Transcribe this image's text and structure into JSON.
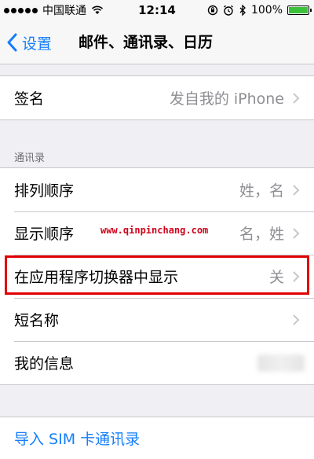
{
  "status_bar": {
    "carrier": "中国联通",
    "time": "12:14",
    "battery_percent": "100%",
    "battery_level": 1.0,
    "icons": [
      "signal-icon",
      "wifi-icon",
      "orientation-lock-icon",
      "alarm-icon",
      "bluetooth-icon",
      "battery-icon"
    ]
  },
  "nav": {
    "back_label": "设置",
    "title": "邮件、通讯录、日历"
  },
  "signature": {
    "label": "签名",
    "value": "发自我的 iPhone"
  },
  "contacts_section": {
    "header": "通讯录",
    "items": [
      {
        "label": "排列顺序",
        "value": "姓，名"
      },
      {
        "label": "显示顺序",
        "value": "名，姓"
      },
      {
        "label": "在应用程序切换器中显示",
        "value": "关"
      },
      {
        "label": "短名称",
        "value": ""
      },
      {
        "label": "我的信息",
        "value": ""
      }
    ]
  },
  "watermark": "www.qinpinchang.com",
  "import_sim": {
    "label": "导入 SIM 卡通讯录"
  },
  "colors": {
    "accent": "#157efb",
    "highlight": "#e00000",
    "battery": "#3cc13b"
  }
}
